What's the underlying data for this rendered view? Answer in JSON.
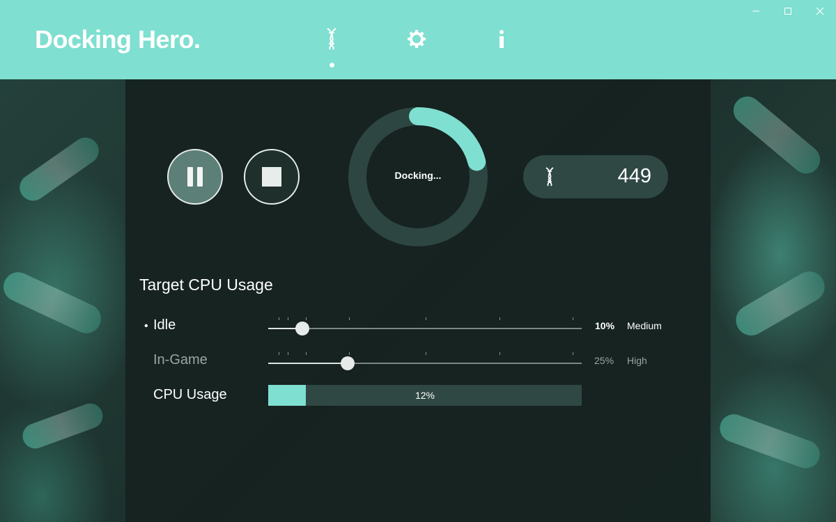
{
  "app": {
    "title": "Docking Hero."
  },
  "nav": {
    "items": [
      {
        "icon": "dna-icon",
        "active": true
      },
      {
        "icon": "gear-icon",
        "active": false
      },
      {
        "icon": "info-icon",
        "active": false
      }
    ]
  },
  "window_controls": {
    "minimize_icon": "minimize-icon",
    "maximize_icon": "maximize-icon",
    "close_icon": "close-icon"
  },
  "controls": {
    "pause_icon": "pause-icon",
    "stop_icon": "stop-icon"
  },
  "status": {
    "label": "Docking...",
    "progress": 0.21
  },
  "counter": {
    "icon": "dna-icon",
    "value": "449"
  },
  "cpu": {
    "title": "Target CPU Usage",
    "rows": [
      {
        "label": "Idle",
        "active": true,
        "value": 0.1,
        "percent": "10%",
        "level": "Medium"
      },
      {
        "label": "In-Game",
        "active": false,
        "value": 0.25,
        "percent": "25%",
        "level": "High"
      }
    ],
    "usage": {
      "label": "CPU Usage",
      "value": 0.12,
      "percent": "12%"
    }
  },
  "colors": {
    "accent": "#7fdfd0",
    "panel": "#162220",
    "ring_track": "#2e4642",
    "counter_bg": "#2f4844"
  }
}
